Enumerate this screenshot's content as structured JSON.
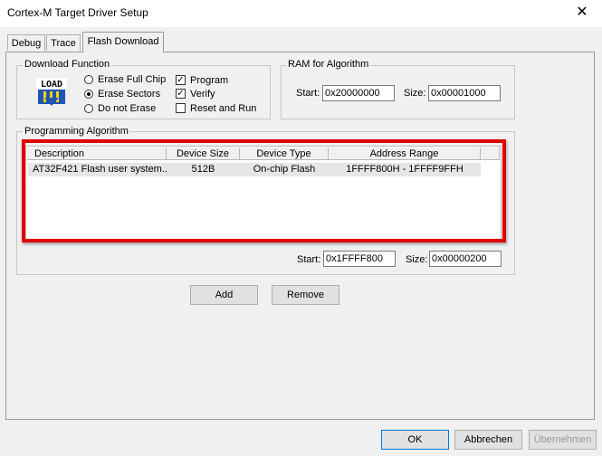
{
  "window": {
    "title": "Cortex-M Target Driver Setup",
    "close_glyph": "✕"
  },
  "tabs": [
    {
      "label": "Debug"
    },
    {
      "label": "Trace"
    },
    {
      "label": "Flash Download",
      "active": true
    }
  ],
  "download_function": {
    "label": "Download Function",
    "icon_text": "LOAD",
    "options": [
      {
        "label": "Erase Full Chip",
        "checked": false
      },
      {
        "label": "Erase Sectors",
        "checked": true
      },
      {
        "label": "Do not Erase",
        "checked": false
      }
    ],
    "checkboxes": [
      {
        "label": "Program",
        "checked": true,
        "mark": "✓"
      },
      {
        "label": "Verify",
        "checked": true,
        "mark": "✓"
      },
      {
        "label": "Reset and Run",
        "checked": false,
        "mark": ""
      }
    ]
  },
  "ram_for_algorithm": {
    "label": "RAM for Algorithm",
    "start_label": "Start:",
    "start_value": "0x20000000",
    "size_label": "Size:",
    "size_value": "0x00001000"
  },
  "programming_algorithm": {
    "label": "Programming Algorithm",
    "columns": [
      "Description",
      "Device Size",
      "Device Type",
      "Address Range"
    ],
    "rows": [
      {
        "description": "AT32F421 Flash user system...",
        "device_size": "512B",
        "device_type": "On-chip Flash",
        "address_range": "1FFFF800H - 1FFFF9FFH"
      }
    ],
    "start_label": "Start:",
    "start_value": "0x1FFFF800",
    "size_label": "Size:",
    "size_value": "0x00000200",
    "highlight_color": "#e00000"
  },
  "buttons": {
    "add": "Add",
    "remove": "Remove",
    "ok": "OK",
    "cancel": "Abbrechen",
    "apply": "Übernehmen"
  }
}
